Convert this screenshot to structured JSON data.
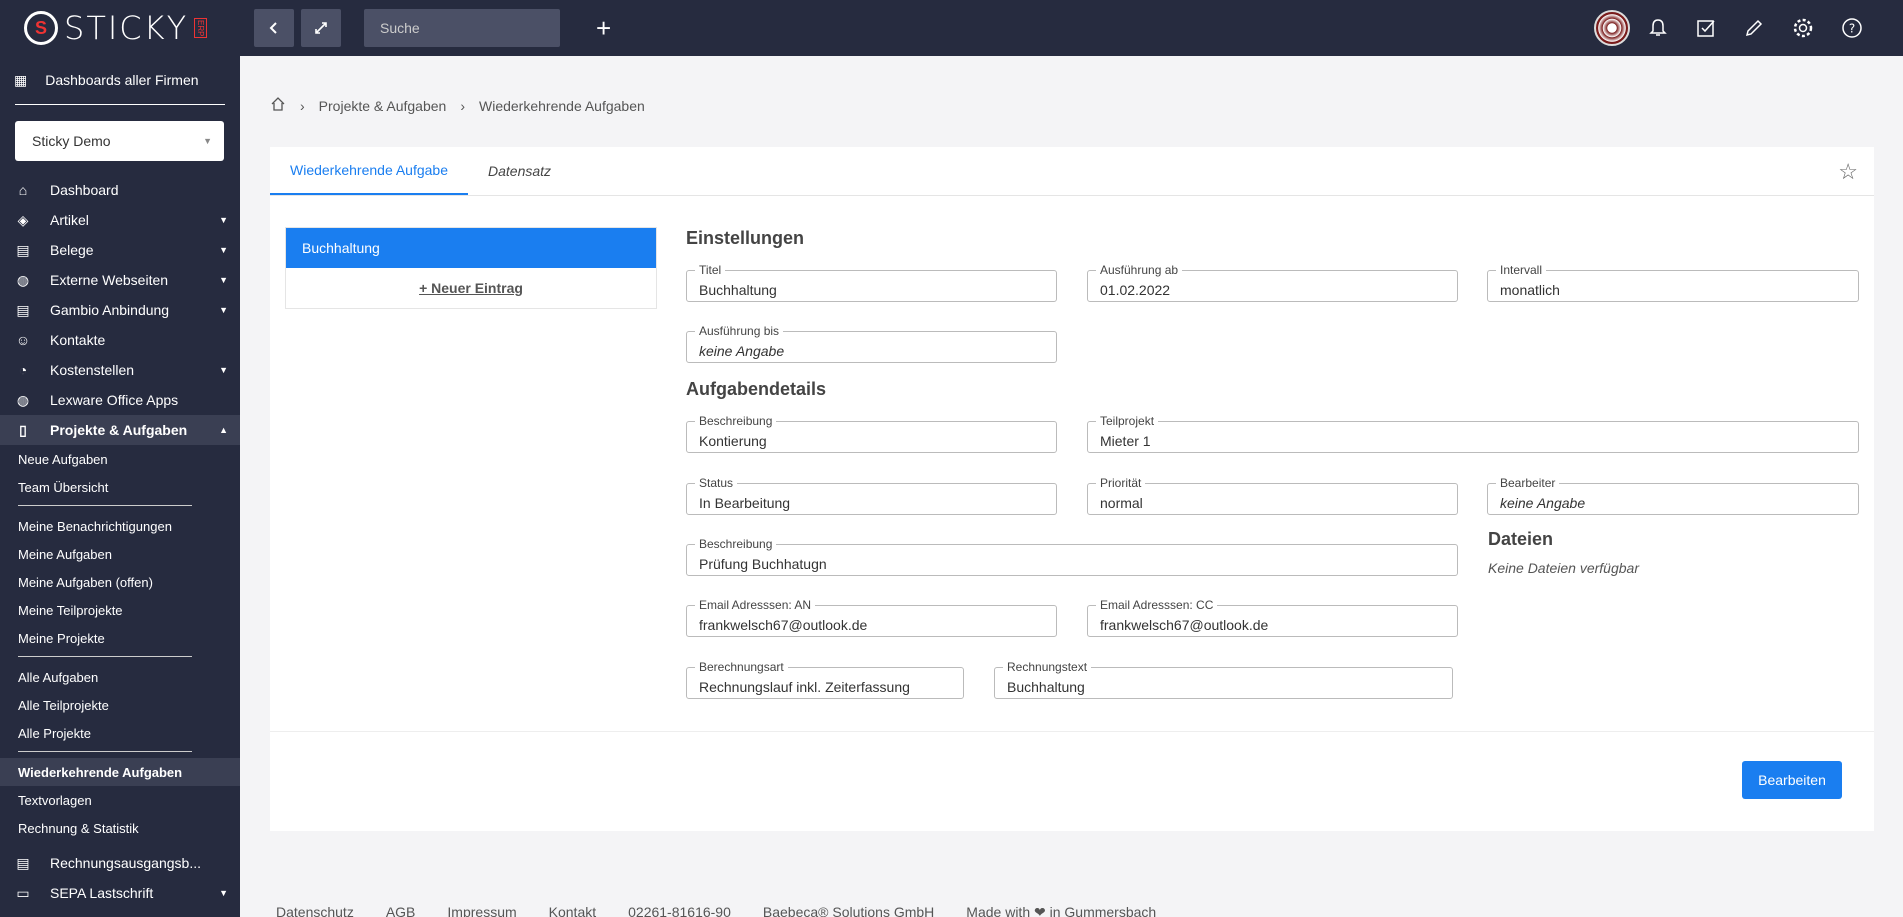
{
  "logo": {
    "text": "STICKY",
    "sub": "ERP"
  },
  "search": {
    "placeholder": "Suche"
  },
  "sidebar": {
    "top_item": "Dashboards aller Firmen",
    "company": "Sticky Demo",
    "items": [
      {
        "label": "Dashboard",
        "icon": "home-icon",
        "caret": false
      },
      {
        "label": "Artikel",
        "icon": "box-icon",
        "caret": true
      },
      {
        "label": "Belege",
        "icon": "document-icon",
        "caret": true
      },
      {
        "label": "Externe Webseiten",
        "icon": "globe-icon",
        "caret": true
      },
      {
        "label": "Gambio Anbindung",
        "icon": "document-icon",
        "caret": true
      },
      {
        "label": "Kontakte",
        "icon": "contact-icon",
        "caret": false
      },
      {
        "label": "Kostenstellen",
        "icon": "pie-chart-icon",
        "caret": true
      },
      {
        "label": "Lexware Office Apps",
        "icon": "globe-icon",
        "caret": false
      },
      {
        "label": "Projekte & Aufgaben",
        "icon": "book-icon",
        "caret": true
      }
    ],
    "sub_group1": [
      "Neue Aufgaben",
      "Team Übersicht"
    ],
    "sub_group2": [
      "Meine Benachrichtigungen",
      "Meine Aufgaben",
      "Meine Aufgaben (offen)",
      "Meine Teilprojekte",
      "Meine Projekte"
    ],
    "sub_group3": [
      "Alle Aufgaben",
      "Alle Teilprojekte",
      "Alle Projekte"
    ],
    "sub_group4": [
      "Wiederkehrende Aufgaben",
      "Textvorlagen",
      "Rechnung & Statistik"
    ],
    "bottom_items": [
      "Rechnungsausgangsb...",
      "SEPA Lastschrift"
    ]
  },
  "breadcrumb": [
    "Projekte & Aufgaben",
    "Wiederkehrende Aufgaben"
  ],
  "tabs": [
    "Wiederkehrende Aufgabe",
    "Datensatz"
  ],
  "list": {
    "selected": "Buchhaltung",
    "new_entry": "+ Neuer Eintrag"
  },
  "sections": {
    "settings": "Einstellungen",
    "details": "Aufgabendetails",
    "files": "Dateien",
    "no_files": "Keine Dateien verfügbar"
  },
  "fields": {
    "titel": {
      "label": "Titel",
      "value": "Buchhaltung"
    },
    "ausfuehrung_ab": {
      "label": "Ausführung ab",
      "value": "01.02.2022"
    },
    "intervall": {
      "label": "Intervall",
      "value": "monatlich"
    },
    "ausfuehrung_bis": {
      "label": "Ausführung bis",
      "value": "keine Angabe"
    },
    "beschreibung1": {
      "label": "Beschreibung",
      "value": "Kontierung"
    },
    "teilprojekt": {
      "label": "Teilprojekt",
      "value": "Mieter 1"
    },
    "status": {
      "label": "Status",
      "value": "In Bearbeitung"
    },
    "prioritaet": {
      "label": "Priorität",
      "value": "normal"
    },
    "bearbeiter": {
      "label": "Bearbeiter",
      "value": "keine Angabe"
    },
    "beschreibung2": {
      "label": "Beschreibung",
      "value": "Prüfung Buchhatugn"
    },
    "email_an": {
      "label": "Email Adresssen: AN",
      "value": "frankwelsch67@outlook.de"
    },
    "email_cc": {
      "label": "Email Adresssen: CC",
      "value": "frankwelsch67@outlook.de"
    },
    "berechnungsart": {
      "label": "Berechnungsart",
      "value": "Rechnungslauf inkl. Zeiterfassung"
    },
    "rechnungstext": {
      "label": "Rechnungstext",
      "value": "Buchhaltung"
    }
  },
  "edit_button": "Bearbeiten",
  "footer": [
    "Datenschutz",
    "AGB",
    "Impressum",
    "Kontakt",
    "02261-81616-90",
    "Baebeca® Solutions GmbH",
    "Made with ❤ in Gummersbach"
  ],
  "colors": {
    "accent": "#1a7ef0",
    "sidebar": "#262b3f"
  }
}
